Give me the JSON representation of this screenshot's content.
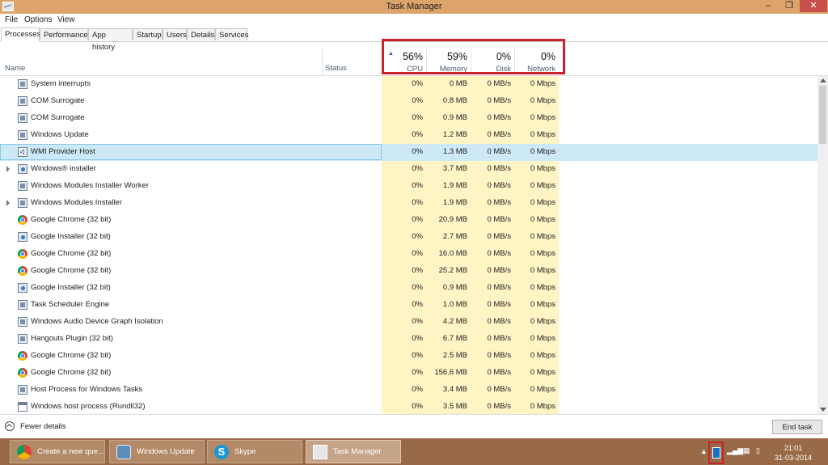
{
  "window": {
    "title": "Task Manager",
    "minimize_label": "‒",
    "maximize_label": "❐",
    "close_label": "✕"
  },
  "menu": [
    "File",
    "Options",
    "View"
  ],
  "tabs": [
    "Processes",
    "Performance",
    "App history",
    "Startup",
    "Users",
    "Details",
    "Services"
  ],
  "active_tab": "Processes",
  "columns": {
    "name_label": "Name",
    "status_label": "Status",
    "cpu": {
      "pct": "56%",
      "label": "CPU"
    },
    "memory": {
      "pct": "59%",
      "label": "Memory"
    },
    "disk": {
      "pct": "0%",
      "label": "Disk"
    },
    "network": {
      "pct": "0%",
      "label": "Network"
    }
  },
  "processes": [
    {
      "name": "System interrupts",
      "icon": "process-icon",
      "expandable": false,
      "selected": false,
      "cpu": "0%",
      "memory": "0 MB",
      "disk": "0 MB/s",
      "network": "0 Mbps"
    },
    {
      "name": "COM Surrogate",
      "icon": "process-icon",
      "expandable": false,
      "selected": false,
      "cpu": "0%",
      "memory": "0.8 MB",
      "disk": "0 MB/s",
      "network": "0 Mbps"
    },
    {
      "name": "COM Surrogate",
      "icon": "process-icon",
      "expandable": false,
      "selected": false,
      "cpu": "0%",
      "memory": "0.9 MB",
      "disk": "0 MB/s",
      "network": "0 Mbps"
    },
    {
      "name": "Windows Update",
      "icon": "process-icon",
      "expandable": false,
      "selected": false,
      "cpu": "0%",
      "memory": "1.2 MB",
      "disk": "0 MB/s",
      "network": "0 Mbps"
    },
    {
      "name": "WMI Provider Host",
      "icon": "gear-icon",
      "expandable": false,
      "selected": true,
      "cpu": "0%",
      "memory": "1.3 MB",
      "disk": "0 MB/s",
      "network": "0 Mbps"
    },
    {
      "name": "Windows® installer",
      "icon": "installer-icon",
      "expandable": true,
      "selected": false,
      "cpu": "0%",
      "memory": "3.7 MB",
      "disk": "0 MB/s",
      "network": "0 Mbps"
    },
    {
      "name": "Windows Modules Installer Worker",
      "icon": "process-icon",
      "expandable": false,
      "selected": false,
      "cpu": "0%",
      "memory": "1.9 MB",
      "disk": "0 MB/s",
      "network": "0 Mbps"
    },
    {
      "name": "Windows Modules Installer",
      "icon": "process-icon",
      "expandable": true,
      "selected": false,
      "cpu": "0%",
      "memory": "1.9 MB",
      "disk": "0 MB/s",
      "network": "0 Mbps"
    },
    {
      "name": "Google Chrome (32 bit)",
      "icon": "chrome-icon",
      "expandable": false,
      "selected": false,
      "cpu": "0%",
      "memory": "20.9 MB",
      "disk": "0 MB/s",
      "network": "0 Mbps"
    },
    {
      "name": "Google Installer (32 bit)",
      "icon": "installer-icon",
      "expandable": false,
      "selected": false,
      "cpu": "0%",
      "memory": "2.7 MB",
      "disk": "0 MB/s",
      "network": "0 Mbps"
    },
    {
      "name": "Google Chrome (32 bit)",
      "icon": "chrome-icon",
      "expandable": false,
      "selected": false,
      "cpu": "0%",
      "memory": "16.0 MB",
      "disk": "0 MB/s",
      "network": "0 Mbps"
    },
    {
      "name": "Google Chrome (32 bit)",
      "icon": "chrome-icon",
      "expandable": false,
      "selected": false,
      "cpu": "0%",
      "memory": "25.2 MB",
      "disk": "0 MB/s",
      "network": "0 Mbps"
    },
    {
      "name": "Google Installer (32 bit)",
      "icon": "installer-icon",
      "expandable": false,
      "selected": false,
      "cpu": "0%",
      "memory": "0.9 MB",
      "disk": "0 MB/s",
      "network": "0 Mbps"
    },
    {
      "name": "Task Scheduler Engine",
      "icon": "process-icon",
      "expandable": false,
      "selected": false,
      "cpu": "0%",
      "memory": "1.0 MB",
      "disk": "0 MB/s",
      "network": "0 Mbps"
    },
    {
      "name": "Windows Audio Device Graph Isolation",
      "icon": "process-icon",
      "expandable": false,
      "selected": false,
      "cpu": "0%",
      "memory": "4.2 MB",
      "disk": "0 MB/s",
      "network": "0 Mbps"
    },
    {
      "name": "Hangouts Plugin (32 bit)",
      "icon": "process-icon",
      "expandable": false,
      "selected": false,
      "cpu": "0%",
      "memory": "6.7 MB",
      "disk": "0 MB/s",
      "network": "0 Mbps"
    },
    {
      "name": "Google Chrome (32 bit)",
      "icon": "chrome-icon",
      "expandable": false,
      "selected": false,
      "cpu": "0%",
      "memory": "2.5 MB",
      "disk": "0 MB/s",
      "network": "0 Mbps"
    },
    {
      "name": "Google Chrome (32 bit)",
      "icon": "chrome-icon",
      "expandable": false,
      "selected": false,
      "cpu": "0%",
      "memory": "156.6 MB",
      "disk": "0 MB/s",
      "network": "0 Mbps"
    },
    {
      "name": "Host Process for Windows Tasks",
      "icon": "process-icon",
      "expandable": false,
      "selected": false,
      "cpu": "0%",
      "memory": "3.4 MB",
      "disk": "0 MB/s",
      "network": "0 Mbps"
    },
    {
      "name": "Windows host process (Rundll32)",
      "icon": "window-icon",
      "expandable": false,
      "selected": false,
      "cpu": "0%",
      "memory": "3.5 MB",
      "disk": "0 MB/s",
      "network": "0 Mbps"
    }
  ],
  "footer": {
    "fewer_details": "Fewer details",
    "end_task": "End task"
  },
  "taskbar": {
    "items": [
      {
        "label": "Create a new que...",
        "icon": "chrome-icon",
        "active": false
      },
      {
        "label": "Windows Update",
        "icon": "windows-update-icon",
        "active": false
      },
      {
        "label": "Skype",
        "icon": "skype-icon",
        "active": false
      },
      {
        "label": "Task Manager",
        "icon": "task-manager-icon",
        "active": true
      }
    ],
    "clock": {
      "time": "21:01",
      "date": "31-03-2014"
    }
  },
  "colors": {
    "title_bar": "#dca36b",
    "taskbar": "#986a48",
    "metric_highlight": "#fff4c4",
    "selection": "#cde8f6",
    "red_highlight": "#c8232c"
  }
}
